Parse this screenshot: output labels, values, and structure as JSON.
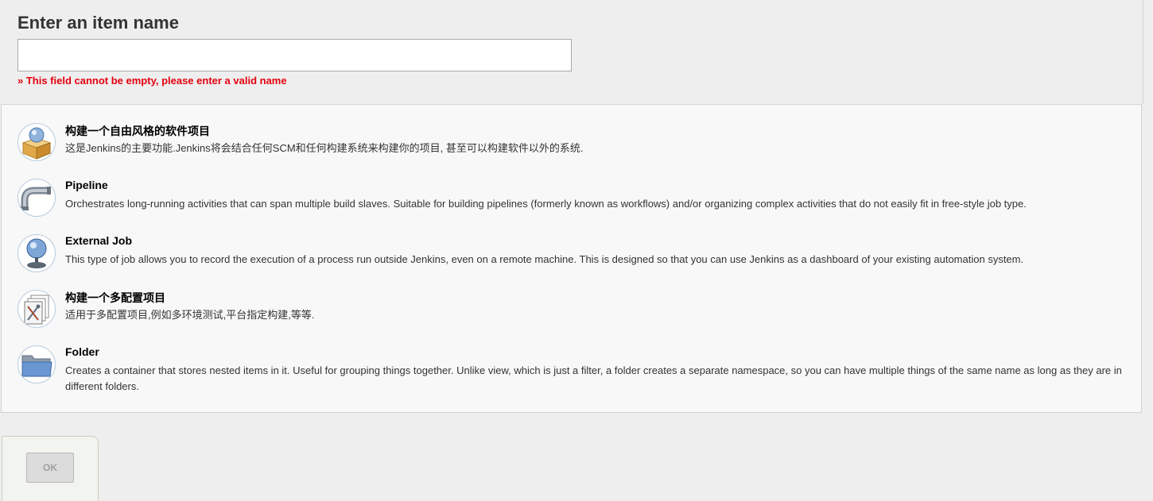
{
  "name_section": {
    "label": "Enter an item name",
    "input_value": "",
    "input_placeholder": "",
    "error": "» This field cannot be empty, please enter a valid name"
  },
  "items": [
    {
      "icon": "freestyle-package-icon",
      "title": "构建一个自由风格的软件项目",
      "description": "这是Jenkins的主要功能.Jenkins将会结合任何SCM和任何构建系统来构建你的项目, 甚至可以构建软件以外的系统."
    },
    {
      "icon": "pipeline-icon",
      "title": "Pipeline",
      "description": "Orchestrates long-running activities that can span multiple build slaves. Suitable for building pipelines (formerly known as workflows) and/or organizing complex activities that do not easily fit in free-style job type."
    },
    {
      "icon": "external-job-monitor-icon",
      "title": "External Job",
      "description": "This type of job allows you to record the execution of a process run outside Jenkins, even on a remote machine. This is designed so that you can use Jenkins as a dashboard of your existing automation system."
    },
    {
      "icon": "multi-config-icon",
      "title": "构建一个多配置项目",
      "description": "适用于多配置项目,例如多环境测试,平台指定构建,等等."
    },
    {
      "icon": "folder-icon",
      "title": "Folder",
      "description": "Creates a container that stores nested items in it. Useful for grouping things together. Unlike view, which is just a filter, a folder creates a separate namespace, so you can have multiple things of the same name as long as they are in different folders."
    }
  ],
  "footer": {
    "ok_label": "OK"
  },
  "colors": {
    "error": "#e4000f",
    "background": "#eeeeee",
    "list_background": "#f8f8f8"
  }
}
